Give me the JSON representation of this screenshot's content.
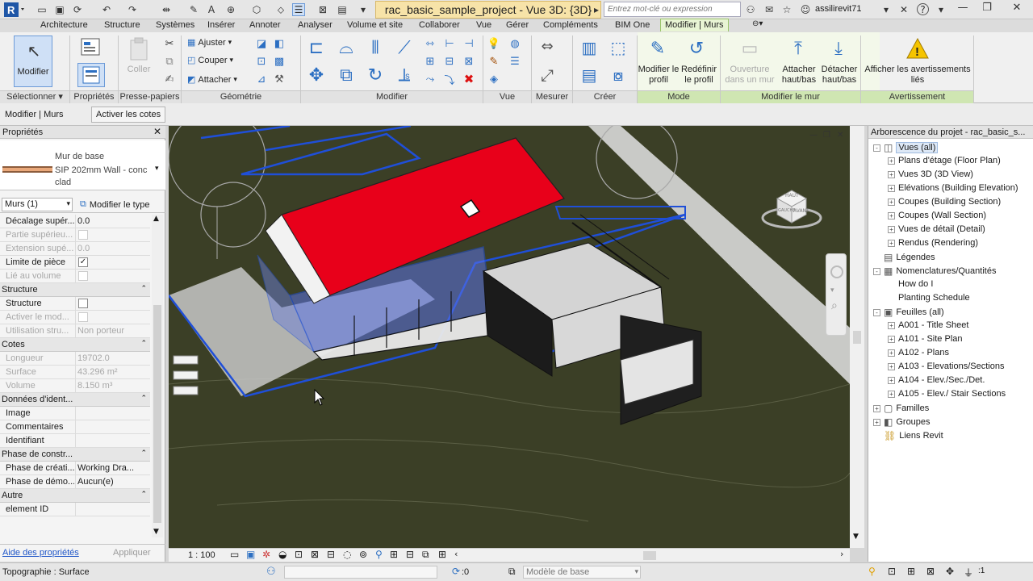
{
  "titlebar": {
    "title": "rac_basic_sample_project - Vue 3D: {3D}",
    "search_placeholder": "Entrez mot-clé ou expression",
    "user": "assilirevit71"
  },
  "tabs": [
    "Architecture",
    "Structure",
    "Systèmes",
    "Insérer",
    "Annoter",
    "Analyser",
    "Volume et site",
    "Collaborer",
    "Vue",
    "Gérer",
    "Compléments",
    "BIM One",
    "Modifier | Murs"
  ],
  "ribbon": {
    "groups": {
      "select": "Sélectionner",
      "properties": "Propriétés",
      "clipboard": "Presse-papiers",
      "geometry": "Géométrie",
      "modify": "Modifier",
      "view": "Vue",
      "measure": "Mesurer",
      "create": "Créer",
      "mode": "Mode",
      "modify_wall": "Modifier le mur",
      "warning": "Avertissement"
    },
    "modify_button": "Modifier",
    "paste_label": "Coller",
    "geometry_cmds": [
      "Ajuster",
      "Couper",
      "Attacher"
    ],
    "edit_profile": "Modifier le profil",
    "reset_profile": "Redéfinir le profil",
    "wall_opening": "Ouverture dans un mur",
    "attach_top_base": "Attacher haut/bas",
    "detach_top_base": "Détacher haut/bas",
    "show_warnings": "Afficher les avertissements liés"
  },
  "optionsbar": {
    "context": "Modifier | Murs",
    "activate_dims": "Activer les cotes"
  },
  "properties": {
    "header": "Propriétés",
    "type_family": "Mur de base",
    "type_name": "SIP 202mm Wall - conc clad",
    "selector": "Murs (1)",
    "edit_type": "Modifier le type",
    "help_link": "Aide des propriétés",
    "apply": "Appliquer",
    "rows": [
      {
        "kind": "row",
        "key": "Décalage supér...",
        "val": "0.0"
      },
      {
        "kind": "row",
        "key": "Partie supérieu...",
        "val": "",
        "cb": "off",
        "dis": true
      },
      {
        "kind": "row",
        "key": "Extension supé...",
        "val": "0.0",
        "dis": true
      },
      {
        "kind": "row",
        "key": "Limite de pièce",
        "val": "",
        "cb": "on"
      },
      {
        "kind": "row",
        "key": "Lié au volume",
        "val": "",
        "cb": "off",
        "dis": true
      },
      {
        "kind": "sec",
        "key": "Structure"
      },
      {
        "kind": "row",
        "key": "Structure",
        "val": "",
        "cb": "off"
      },
      {
        "kind": "row",
        "key": "Activer le mod...",
        "val": "",
        "cb": "off",
        "dis": true
      },
      {
        "kind": "row",
        "key": "Utilisation stru...",
        "val": "Non porteur",
        "dis": true
      },
      {
        "kind": "sec",
        "key": "Cotes"
      },
      {
        "kind": "row",
        "key": "Longueur",
        "val": "19702.0",
        "dis": true
      },
      {
        "kind": "row",
        "key": "Surface",
        "val": "43.296 m²",
        "dis": true
      },
      {
        "kind": "row",
        "key": "Volume",
        "val": "8.150 m³",
        "dis": true
      },
      {
        "kind": "sec",
        "key": "Données d'ident..."
      },
      {
        "kind": "row",
        "key": "Image",
        "val": ""
      },
      {
        "kind": "row",
        "key": "Commentaires",
        "val": ""
      },
      {
        "kind": "row",
        "key": "Identifiant",
        "val": ""
      },
      {
        "kind": "sec",
        "key": "Phase de constr..."
      },
      {
        "kind": "row",
        "key": "Phase de créati...",
        "val": "Working Dra..."
      },
      {
        "kind": "row",
        "key": "Phase de démo...",
        "val": "Aucun(e)"
      },
      {
        "kind": "sec",
        "key": "Autre"
      },
      {
        "kind": "row",
        "key": "element ID",
        "val": ""
      }
    ]
  },
  "viewcube": {
    "face_top": "HAUT",
    "face_left": "GAUCHE",
    "face_front": "AVANT"
  },
  "viewbar": {
    "scale": "1 : 100"
  },
  "browser": {
    "header": "Arborescence du projet - rac_basic_s...",
    "items": [
      {
        "label": "Vues (all)",
        "level": 0,
        "exp": "-",
        "icon": "views-icon",
        "sel": true
      },
      {
        "label": "Plans d'étage (Floor Plan)",
        "level": 1,
        "exp": "+"
      },
      {
        "label": "Vues 3D (3D View)",
        "level": 1,
        "exp": "+"
      },
      {
        "label": "Elévations (Building Elevation)",
        "level": 1,
        "exp": "+"
      },
      {
        "label": "Coupes (Building Section)",
        "level": 1,
        "exp": "+"
      },
      {
        "label": "Coupes (Wall Section)",
        "level": 1,
        "exp": "+"
      },
      {
        "label": "Vues de détail (Detail)",
        "level": 1,
        "exp": "+"
      },
      {
        "label": "Rendus (Rendering)",
        "level": 1,
        "exp": "+"
      },
      {
        "label": "Légendes",
        "level": 0,
        "exp": "",
        "icon": "legend-icon"
      },
      {
        "label": "Nomenclatures/Quantités",
        "level": 0,
        "exp": "-",
        "icon": "schedule-icon"
      },
      {
        "label": "How do I",
        "level": 1,
        "exp": ""
      },
      {
        "label": "Planting Schedule",
        "level": 1,
        "exp": ""
      },
      {
        "label": "Feuilles (all)",
        "level": 0,
        "exp": "-",
        "icon": "sheets-icon"
      },
      {
        "label": "A001 - Title Sheet",
        "level": 1,
        "exp": "+"
      },
      {
        "label": "A101 - Site Plan",
        "level": 1,
        "exp": "+"
      },
      {
        "label": "A102 - Plans",
        "level": 1,
        "exp": "+"
      },
      {
        "label": "A103 - Elevations/Sections",
        "level": 1,
        "exp": "+"
      },
      {
        "label": "A104 - Elev./Sec./Det.",
        "level": 1,
        "exp": "+"
      },
      {
        "label": "A105 - Elev./ Stair Sections",
        "level": 1,
        "exp": "+"
      },
      {
        "label": "Familles",
        "level": 0,
        "exp": "+",
        "icon": "families-icon"
      },
      {
        "label": "Groupes",
        "level": 0,
        "exp": "+",
        "icon": "groups-icon"
      },
      {
        "label": "Liens Revit",
        "level": 0,
        "exp": "",
        "icon": "links-icon"
      }
    ]
  },
  "statusbar": {
    "message": "Topographie : Surface",
    "workset_count": ":0",
    "design_option": "Modèle de base"
  },
  "colors": {
    "roof_red": "#e8001a",
    "selection_blue": "#1f4fd8",
    "ground": "#3b3f26"
  }
}
